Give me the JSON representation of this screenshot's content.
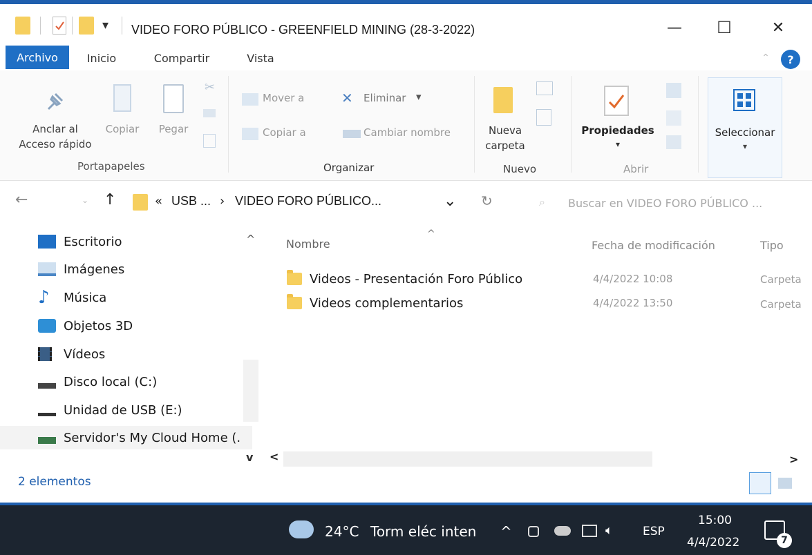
{
  "window": {
    "title": "VIDEO FORO PÚBLICO - GREENFIELD MINING (28-3-2022)",
    "minimize_glyph": "—",
    "maximize_glyph": "☐",
    "close_glyph": "✕",
    "qa_dropdown_glyph": "▾"
  },
  "tabs": {
    "archivo": "Archivo",
    "inicio": "Inicio",
    "compartir": "Compartir",
    "vista": "Vista",
    "help_glyph": "?"
  },
  "ribbon": {
    "portapapeles": {
      "group": "Portapapeles",
      "pin_line1": "Anclar al",
      "pin_line2": "Acceso rápido",
      "copy": "Copiar",
      "paste": "Pegar"
    },
    "organizar": {
      "group": "Organizar",
      "move_to": "Mover a",
      "copy_to": "Copiar a",
      "delete": "Eliminar",
      "rename": "Cambiar nombre",
      "dropdown_glyph": "▾"
    },
    "nuevo": {
      "group": "Nuevo",
      "new_folder_line1": "Nueva",
      "new_folder_line2": "carpeta"
    },
    "abrir": {
      "group": "Abrir",
      "properties": "Propiedades",
      "dropdown_glyph": "▾"
    },
    "seleccionar": {
      "label": "Seleccionar",
      "dropdown_glyph": "▾"
    }
  },
  "address": {
    "back_glyph": "←",
    "up_glyph": "↑",
    "overflow": "«",
    "crumb_usb": "USB ...",
    "crumb_sep": "›",
    "crumb_current": "VIDEO FORO PÚBLICO...",
    "dropdown_glyph": "⌄",
    "refresh_glyph": "↻",
    "search_placeholder": "Buscar en VIDEO FORO PÚBLICO ..."
  },
  "nav": {
    "items": [
      {
        "label": "Escritorio"
      },
      {
        "label": "Imágenes"
      },
      {
        "label": "Música"
      },
      {
        "label": "Objetos 3D"
      },
      {
        "label": "Vídeos"
      },
      {
        "label": "Disco local (C:)"
      },
      {
        "label": "Unidad de USB (E:)"
      },
      {
        "label": "Servidor's My Cloud Home (."
      }
    ],
    "scroll_up_glyph": "^",
    "scroll_down_glyph": "v"
  },
  "content": {
    "sort_glyph": "^",
    "col_name": "Nombre",
    "col_date": "Fecha de modificación",
    "col_type": "Tipo",
    "rows": [
      {
        "name": "Videos - Presentación Foro Público",
        "date": "4/4/2022 10:08",
        "type": "Carpeta"
      },
      {
        "name": "Videos complementarios",
        "date": "4/4/2022 13:50",
        "type": "Carpeta"
      }
    ],
    "hscroll_left_glyph": "<",
    "hscroll_right_glyph": ">"
  },
  "status": {
    "count": "2 elementos"
  },
  "taskbar": {
    "temperature": "24°C",
    "weather": "Torm eléc inten",
    "chevron": "^",
    "lang": "ESP",
    "time": "15:00",
    "date": "4/4/2022",
    "notif_count": "7"
  },
  "colors": {
    "accent": "#1f6fc5",
    "folder": "#f6cf5e",
    "taskbar": "#1c2530"
  }
}
